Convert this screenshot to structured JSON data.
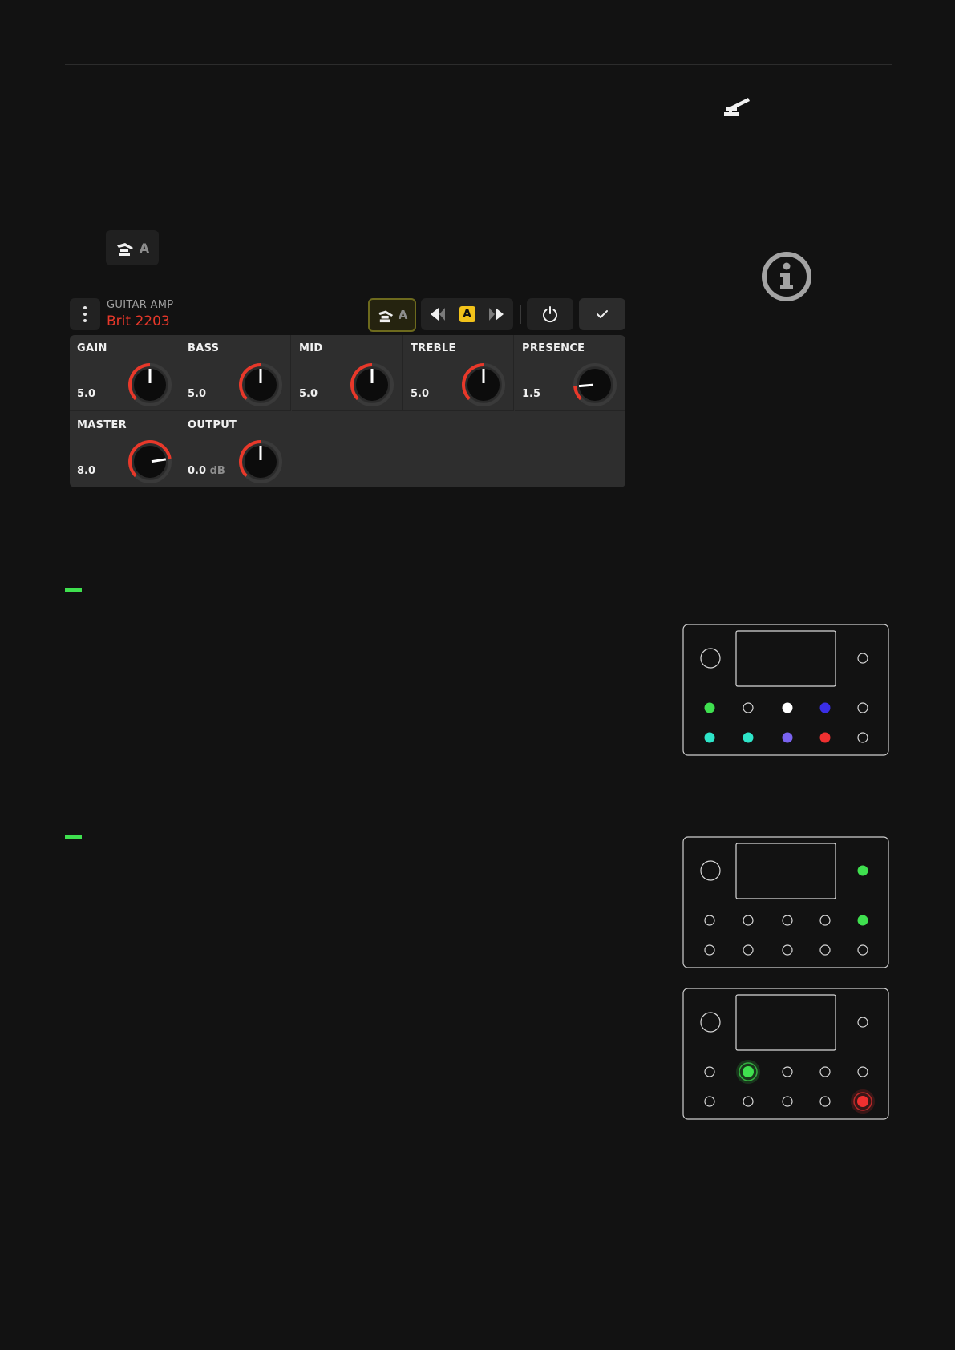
{
  "tag_button": {
    "letter": "A",
    "icon": "expression-pedal-icon"
  },
  "top_icon": "expression-pedal-icon",
  "info_icon": "info-circle-icon",
  "amp_block": {
    "type_label": "GUITAR AMP",
    "model_name": "Brit 2203",
    "exp_button_letter": "A",
    "nav_badge": "A",
    "icons": {
      "menu": "vertical-dots-icon",
      "exp": "expression-pedal-icon",
      "prev": "triangle-left-icon",
      "next": "triangle-right-icon",
      "power": "power-icon",
      "confirm": "check-icon"
    },
    "knobs": [
      {
        "label": "GAIN",
        "value": "5.0",
        "unit": "",
        "level": 0.5
      },
      {
        "label": "BASS",
        "value": "5.0",
        "unit": "",
        "level": 0.5
      },
      {
        "label": "MID",
        "value": "5.0",
        "unit": "",
        "level": 0.5
      },
      {
        "label": "TREBLE",
        "value": "5.0",
        "unit": "",
        "level": 0.5
      },
      {
        "label": "PRESENCE",
        "value": "1.5",
        "unit": "",
        "level": 0.15
      },
      {
        "label": "MASTER",
        "value": "8.0",
        "unit": "",
        "level": 0.8
      },
      {
        "label": "OUTPUT",
        "value": "0.0",
        "unit": "dB",
        "level": 0.5
      }
    ]
  },
  "colors": {
    "accent_red": "#e8382a",
    "exp_yellow": "#f2c21a",
    "green": "#3fe04f",
    "teal": "#2ee5c9",
    "blue": "#3a2ee6",
    "violet": "#7a63f0",
    "red": "#f03030",
    "white": "#ffffff"
  },
  "devices": [
    {
      "id": "device-1",
      "top_right": "off",
      "rows": [
        [
          "green",
          "off",
          "white",
          "blue",
          "off"
        ],
        [
          "teal",
          "teal",
          "violet",
          "red",
          "off"
        ]
      ]
    },
    {
      "id": "device-2",
      "top_right": "green",
      "rows": [
        [
          "off",
          "off",
          "off",
          "off",
          "green"
        ],
        [
          "off",
          "off",
          "off",
          "off",
          "off"
        ]
      ]
    },
    {
      "id": "device-3",
      "top_right": "off",
      "rows": [
        [
          "off",
          "green-ring",
          "off",
          "off",
          "off"
        ],
        [
          "off",
          "off",
          "off",
          "off",
          "red-ring"
        ]
      ]
    }
  ]
}
